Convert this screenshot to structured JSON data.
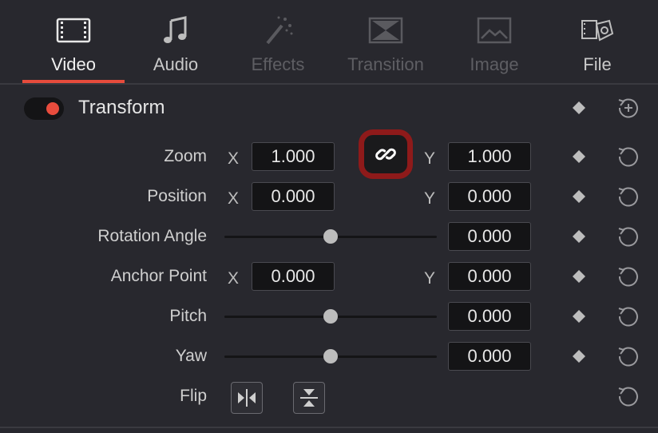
{
  "tabs": [
    {
      "label": "Video",
      "icon": "film-strip-icon",
      "state": "active"
    },
    {
      "label": "Audio",
      "icon": "music-note-icon",
      "state": "normal"
    },
    {
      "label": "Effects",
      "icon": "magic-wand-icon",
      "state": "disabled"
    },
    {
      "label": "Transition",
      "icon": "transition-icon",
      "state": "disabled"
    },
    {
      "label": "Image",
      "icon": "image-icon",
      "state": "disabled"
    },
    {
      "label": "File",
      "icon": "file-film-icon",
      "state": "normal"
    }
  ],
  "section": {
    "title": "Transform",
    "enabled": true
  },
  "rows": {
    "zoom": {
      "label": "Zoom",
      "x_axis": "X",
      "x": "1.000",
      "y_axis": "Y",
      "y": "1.000",
      "linked": true
    },
    "position": {
      "label": "Position",
      "x_axis": "X",
      "x": "0.000",
      "y_axis": "Y",
      "y": "0.000"
    },
    "rotation": {
      "label": "Rotation Angle",
      "value": "0.000",
      "slider_position": 0.5
    },
    "anchor": {
      "label": "Anchor Point",
      "x_axis": "X",
      "x": "0.000",
      "y_axis": "Y",
      "y": "0.000"
    },
    "pitch": {
      "label": "Pitch",
      "value": "0.000",
      "slider_position": 0.5
    },
    "yaw": {
      "label": "Yaw",
      "value": "0.000",
      "slider_position": 0.5
    },
    "flip": {
      "label": "Flip"
    }
  },
  "colors": {
    "accent": "#e64b3c",
    "highlight_border": "#8e1a1a",
    "background": "#28282e",
    "field_bg": "#141416"
  }
}
